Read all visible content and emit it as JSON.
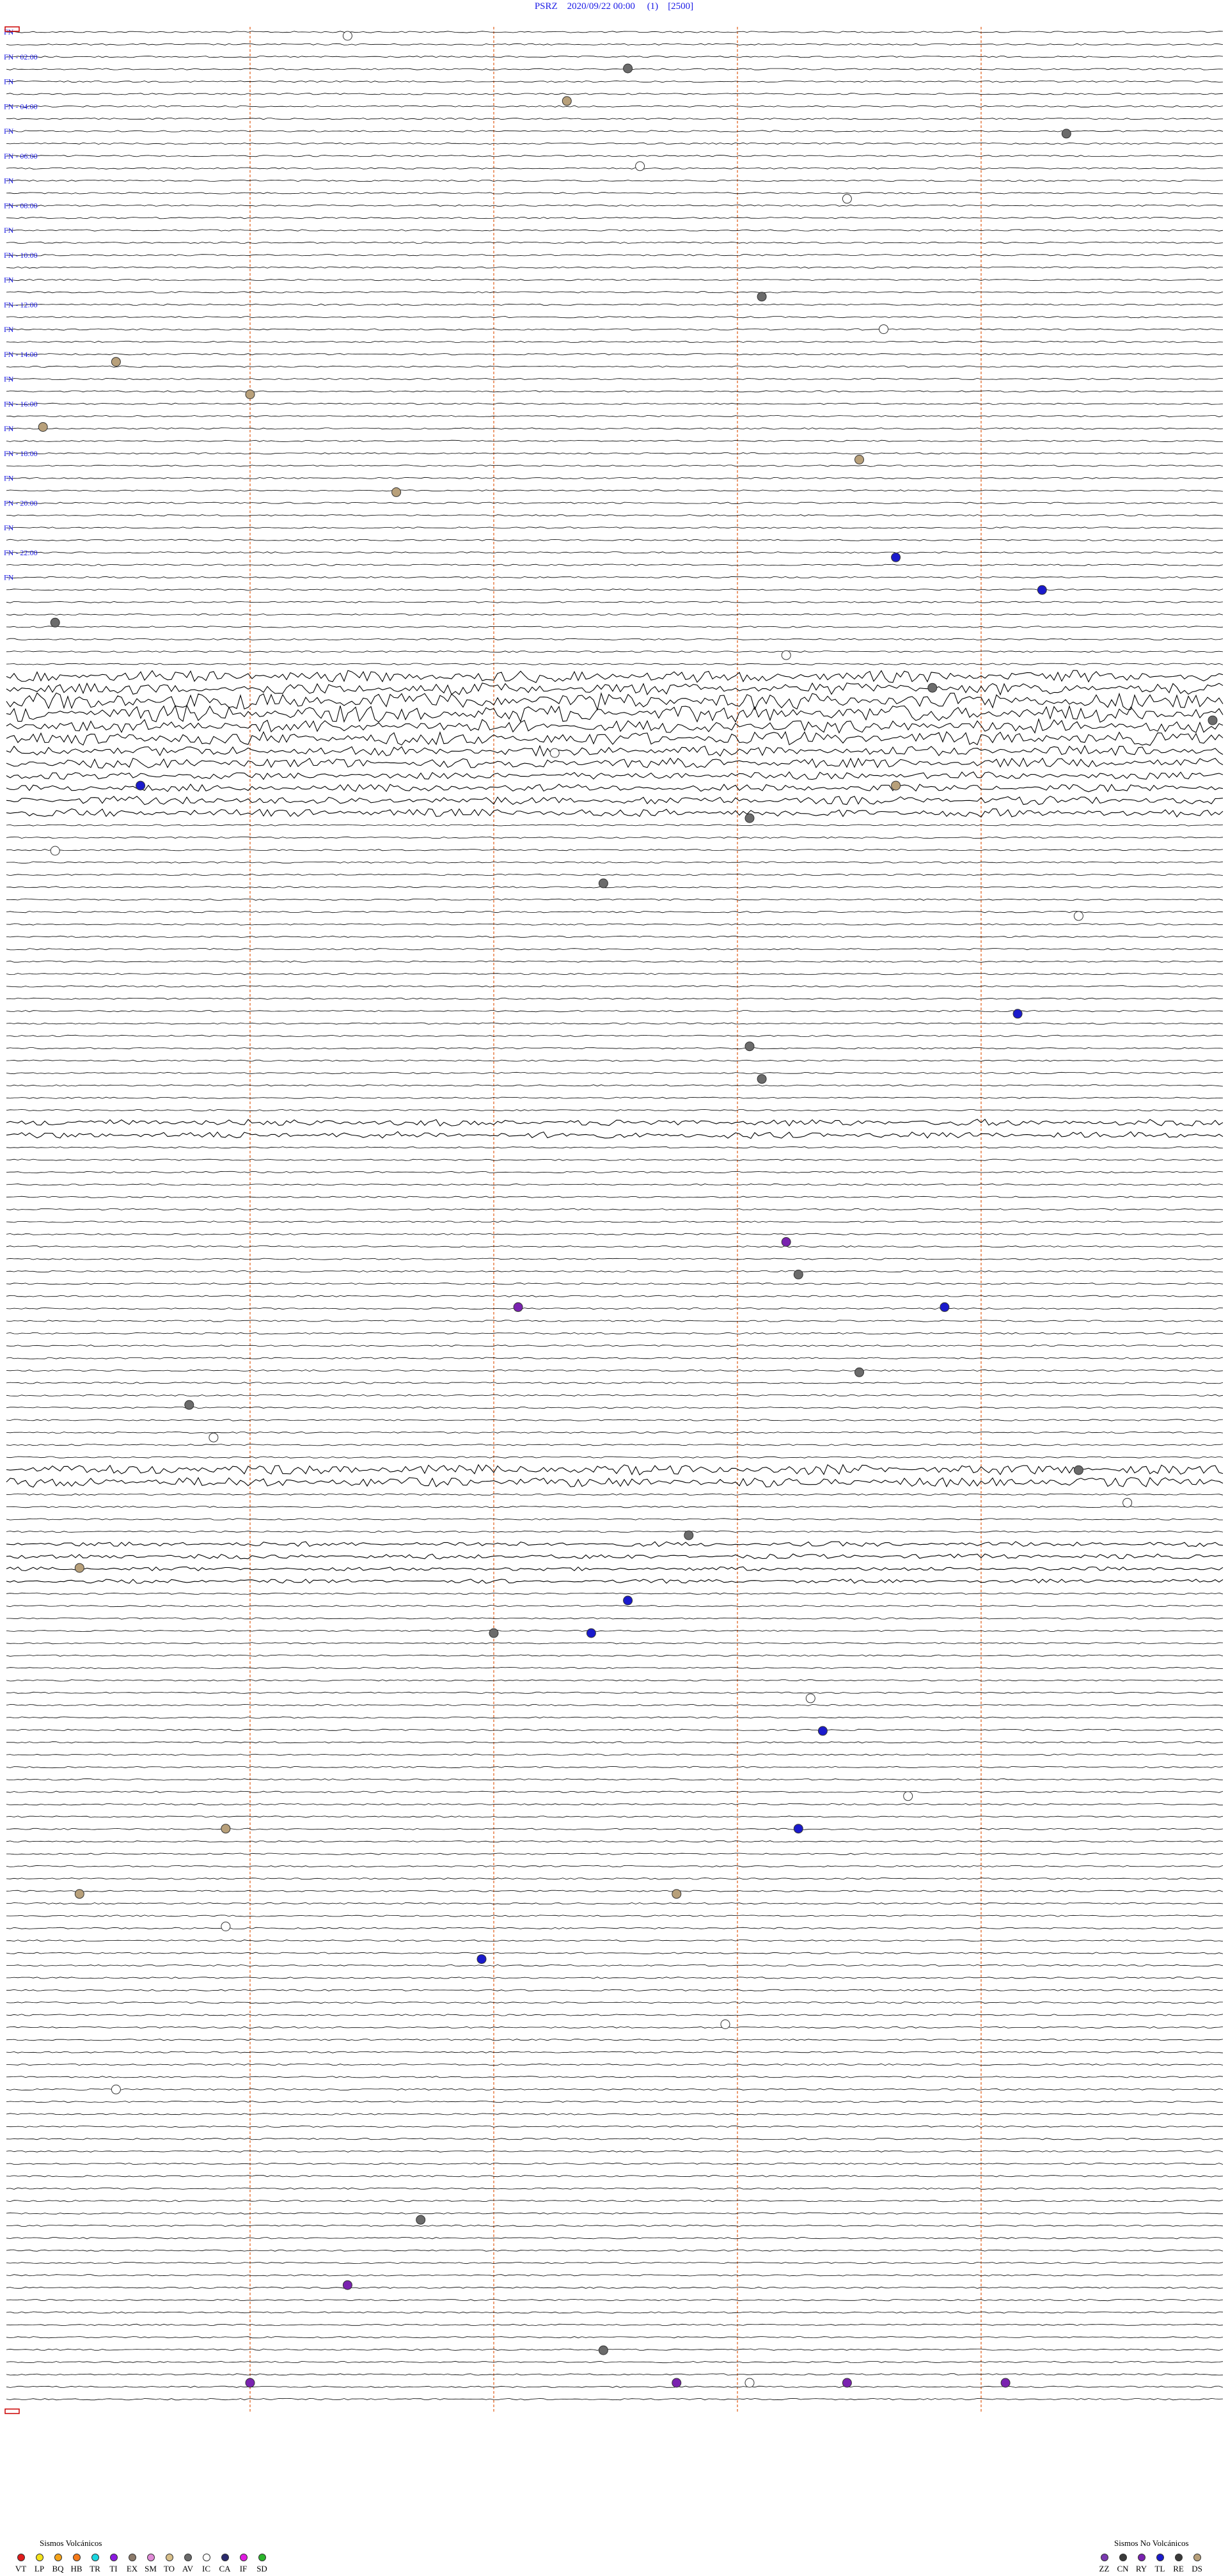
{
  "header": {
    "station": "PSRZ",
    "datetime": "2020/09/22 00:00",
    "channel": "(1)",
    "scale": "[2500]"
  },
  "colors": {
    "hour_label": "#1a1ae6",
    "minute_marks": "#e05a14",
    "trace": "#000000",
    "start_marker": "#cc0000"
  },
  "chart_data": {
    "type": "helicorder",
    "title": "PSRZ   2020/09/22 00:00   (1)   [2500]",
    "hour_labels": [
      {
        "hour": 0,
        "text": "FN"
      },
      {
        "hour": 2,
        "text": "FN - 02:00"
      },
      {
        "hour": 4,
        "text": "FN"
      },
      {
        "hour": 6,
        "text": "FN - 04:00"
      },
      {
        "hour": 8,
        "text": "FN"
      },
      {
        "hour": 10,
        "text": "FN - 06:00"
      },
      {
        "hour": 12,
        "text": "FN"
      },
      {
        "hour": 14,
        "text": "FN - 08:00"
      },
      {
        "hour": 16,
        "text": "FN"
      },
      {
        "hour": 18,
        "text": "FN - 10:00"
      },
      {
        "hour": 20,
        "text": "FN"
      },
      {
        "hour": 22,
        "text": "FN - 12:00"
      },
      {
        "hour": 24,
        "text": "FN"
      },
      {
        "hour": 26,
        "text": "FN - 14:00"
      },
      {
        "hour": 28,
        "text": "FN"
      },
      {
        "hour": 30,
        "text": "FN - 16:00"
      },
      {
        "hour": 32,
        "text": "FN"
      },
      {
        "hour": 34,
        "text": "FN - 18:00"
      },
      {
        "hour": 36,
        "text": "FN"
      },
      {
        "hour": 38,
        "text": "FN - 20:00"
      },
      {
        "hour": 40,
        "text": "FN"
      },
      {
        "hour": 42,
        "text": "FN - 22:00"
      },
      {
        "hour": 44,
        "text": "FN"
      }
    ],
    "events": [
      {
        "row": 0,
        "t": 0.28,
        "type": "IC"
      },
      {
        "row": 1,
        "t": 0.51,
        "type": "AV"
      },
      {
        "row": 2,
        "t": 0.46,
        "type": "DS"
      },
      {
        "row": 3,
        "t": 0.87,
        "type": "AV"
      },
      {
        "row": 4,
        "t": 0.52,
        "type": "IC"
      },
      {
        "row": 5,
        "t": 0.69,
        "type": "IC"
      },
      {
        "row": 8,
        "t": 0.62,
        "type": "AV"
      },
      {
        "row": 9,
        "t": 0.72,
        "type": "IC"
      },
      {
        "row": 10,
        "t": 0.09,
        "type": "DS"
      },
      {
        "row": 11,
        "t": 0.2,
        "type": "DS"
      },
      {
        "row": 12,
        "t": 0.03,
        "type": "DS"
      },
      {
        "row": 13,
        "t": 0.7,
        "type": "DS"
      },
      {
        "row": 14,
        "t": 0.32,
        "type": "DS"
      },
      {
        "row": 16,
        "t": 0.73,
        "type": "TL"
      },
      {
        "row": 17,
        "t": 0.85,
        "type": "TL"
      },
      {
        "row": 18,
        "t": 0.04,
        "type": "AV"
      },
      {
        "row": 19,
        "t": 0.64,
        "type": "IC"
      },
      {
        "row": 20,
        "t": 0.76,
        "type": "AV"
      },
      {
        "row": 21,
        "t": 0.99,
        "type": "AV"
      },
      {
        "row": 22,
        "t": 0.45,
        "type": "IC"
      },
      {
        "row": 23,
        "t": 0.11,
        "type": "TL"
      },
      {
        "row": 23,
        "t": 0.73,
        "type": "DS"
      },
      {
        "row": 24,
        "t": 0.61,
        "type": "AV"
      },
      {
        "row": 25,
        "t": 0.04,
        "type": "IC"
      },
      {
        "row": 26,
        "t": 0.49,
        "type": "AV"
      },
      {
        "row": 27,
        "t": 0.88,
        "type": "IC"
      },
      {
        "row": 30,
        "t": 0.83,
        "type": "TL"
      },
      {
        "row": 31,
        "t": 0.61,
        "type": "AV"
      },
      {
        "row": 32,
        "t": 0.62,
        "type": "AV"
      },
      {
        "row": 37,
        "t": 0.64,
        "type": "RY"
      },
      {
        "row": 38,
        "t": 0.65,
        "type": "AV"
      },
      {
        "row": 39,
        "t": 0.42,
        "type": "RY"
      },
      {
        "row": 39,
        "t": 0.77,
        "type": "TL"
      },
      {
        "row": 41,
        "t": 0.7,
        "type": "AV"
      },
      {
        "row": 42,
        "t": 0.15,
        "type": "AV"
      },
      {
        "row": 43,
        "t": 0.17,
        "type": "IC"
      },
      {
        "row": 44,
        "t": 0.88,
        "type": "AV"
      },
      {
        "row": 45,
        "t": 0.92,
        "type": "IC"
      },
      {
        "row": 46,
        "t": 0.56,
        "type": "AV"
      },
      {
        "row": 47,
        "t": 0.06,
        "type": "DS"
      },
      {
        "row": 48,
        "t": 0.51,
        "type": "TL"
      },
      {
        "row": 49,
        "t": 0.4,
        "type": "AV"
      },
      {
        "row": 49,
        "t": 0.48,
        "type": "TL"
      },
      {
        "row": 51,
        "t": 0.66,
        "type": "IC"
      },
      {
        "row": 52,
        "t": 0.67,
        "type": "TL"
      },
      {
        "row": 54,
        "t": 0.74,
        "type": "IC"
      },
      {
        "row": 55,
        "t": 0.65,
        "type": "TL"
      },
      {
        "row": 55,
        "t": 0.18,
        "type": "DS"
      },
      {
        "row": 57,
        "t": 0.06,
        "type": "DS"
      },
      {
        "row": 57,
        "t": 0.55,
        "type": "DS"
      },
      {
        "row": 58,
        "t": 0.18,
        "type": "IC"
      },
      {
        "row": 59,
        "t": 0.39,
        "type": "TL"
      },
      {
        "row": 61,
        "t": 0.59,
        "type": "IC"
      },
      {
        "row": 63,
        "t": 0.09,
        "type": "IC"
      },
      {
        "row": 67,
        "t": 0.34,
        "type": "AV"
      },
      {
        "row": 69,
        "t": 0.28,
        "type": "RY"
      },
      {
        "row": 71,
        "t": 0.49,
        "type": "AV"
      },
      {
        "row": 72,
        "t": 0.2,
        "type": "RY"
      },
      {
        "row": 72,
        "t": 0.55,
        "type": "RY"
      },
      {
        "row": 72,
        "t": 0.69,
        "type": "RY"
      },
      {
        "row": 72,
        "t": 0.82,
        "type": "RY"
      },
      {
        "row": 72,
        "t": 0.61,
        "type": "IC"
      }
    ]
  },
  "legend_volcanic": {
    "title": "Sismos Volcánicos",
    "items": [
      {
        "code": "VT",
        "color": "#e01b1b"
      },
      {
        "code": "LP",
        "color": "#f5e31a"
      },
      {
        "code": "BQ",
        "color": "#f5a31a"
      },
      {
        "code": "HB",
        "color": "#f57a1a"
      },
      {
        "code": "TR",
        "color": "#1ad6e0"
      },
      {
        "code": "TI",
        "color": "#8b1ae0"
      },
      {
        "code": "EX",
        "color": "#8c7a6a"
      },
      {
        "code": "SM",
        "color": "#e08ad6"
      },
      {
        "code": "TO",
        "color": "#d9c08a"
      },
      {
        "code": "AV",
        "color": "#6b6b6b"
      },
      {
        "code": "IC",
        "color": "#ffffff"
      },
      {
        "code": "CA",
        "color": "#2a2a6e"
      },
      {
        "code": "IF",
        "color": "#e01be0"
      },
      {
        "code": "SD",
        "color": "#2bb52b"
      }
    ]
  },
  "legend_nonvolcanic": {
    "title": "Sismos No Volcánicos",
    "items": [
      {
        "code": "ZZ",
        "color": "#7a3ab0"
      },
      {
        "code": "CN",
        "color": "#3a3a3a"
      },
      {
        "code": "RY",
        "color": "#7a22b0"
      },
      {
        "code": "TL",
        "color": "#1a1acc"
      },
      {
        "code": "RE",
        "color": "#3a3a3a"
      },
      {
        "code": "DS",
        "color": "#b8a07a"
      }
    ]
  }
}
